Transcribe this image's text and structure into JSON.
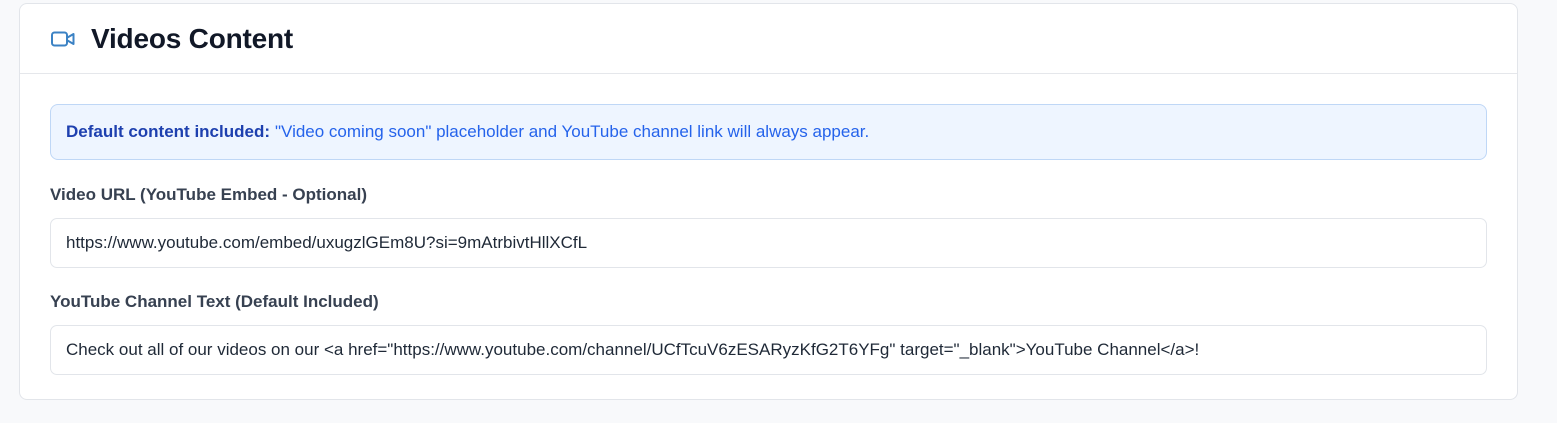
{
  "section": {
    "title": "Videos Content",
    "icon": "video-camera-icon",
    "accent_color": "#3b82c4"
  },
  "notice": {
    "strong_label": "Default content included:",
    "text": "\"Video coming soon\" placeholder and YouTube channel link will always appear.",
    "background_color": "#eef5ff",
    "text_color": "#2563eb"
  },
  "fields": {
    "video_url": {
      "label": "Video URL (YouTube Embed - Optional)",
      "value": "https://www.youtube.com/embed/uxugzlGEm8U?si=9mAtrbivtHllXCfL"
    },
    "channel_text": {
      "label": "YouTube Channel Text (Default Included)",
      "value": "Check out all of our videos on our <a href=\"https://www.youtube.com/channel/UCfTcuV6zESARyzKfG2T6YFg\" target=\"_blank\">YouTube Channel</a>!"
    }
  }
}
